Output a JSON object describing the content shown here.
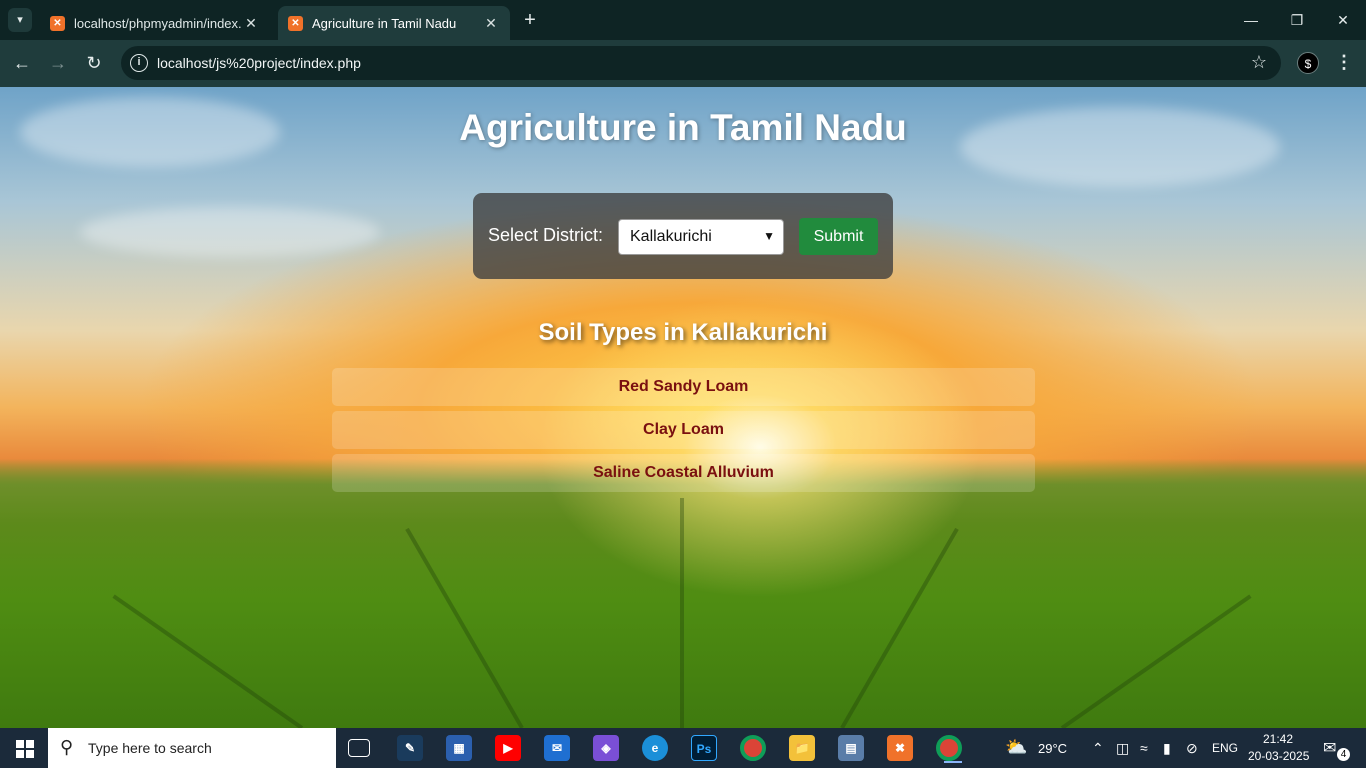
{
  "browser": {
    "tabs": [
      {
        "title": "localhost/phpmyadmin/index.p",
        "active": false
      },
      {
        "title": "Agriculture in Tamil Nadu",
        "active": true
      }
    ],
    "url": "localhost/js%20project/index.php",
    "icons": {
      "tab_menu": "▾",
      "close": "✕",
      "new_tab": "+",
      "minimize": "—",
      "restore": "❐",
      "window_close": "✕",
      "back": "←",
      "forward": "→",
      "reload": "↻",
      "site_info": "i",
      "bookmark": "☆",
      "extension": "$",
      "menu": "⋮"
    }
  },
  "page": {
    "title": "Agriculture in Tamil Nadu",
    "form": {
      "label": "Select District:",
      "selected_district": "Kallakurichi",
      "submit_label": "Submit"
    },
    "soil_heading": "Soil Types in Kallakurichi",
    "soil_types": [
      "Red Sandy Loam",
      "Clay Loam",
      "Saline Coastal Alluvium"
    ],
    "colors": {
      "submit": "#218b3d",
      "soil_text": "#7a1010"
    }
  },
  "taskbar": {
    "search_placeholder": "Type here to search",
    "weather": "29°C",
    "language": "ENG",
    "time": "21:42",
    "date": "20-03-2025",
    "notifications": "4",
    "apps": [
      "task-view",
      "app-pen",
      "store",
      "youtube",
      "mail",
      "m365",
      "edge",
      "photoshop",
      "chrome",
      "file-explorer",
      "network-app",
      "xampp",
      "chrome-profile"
    ]
  }
}
